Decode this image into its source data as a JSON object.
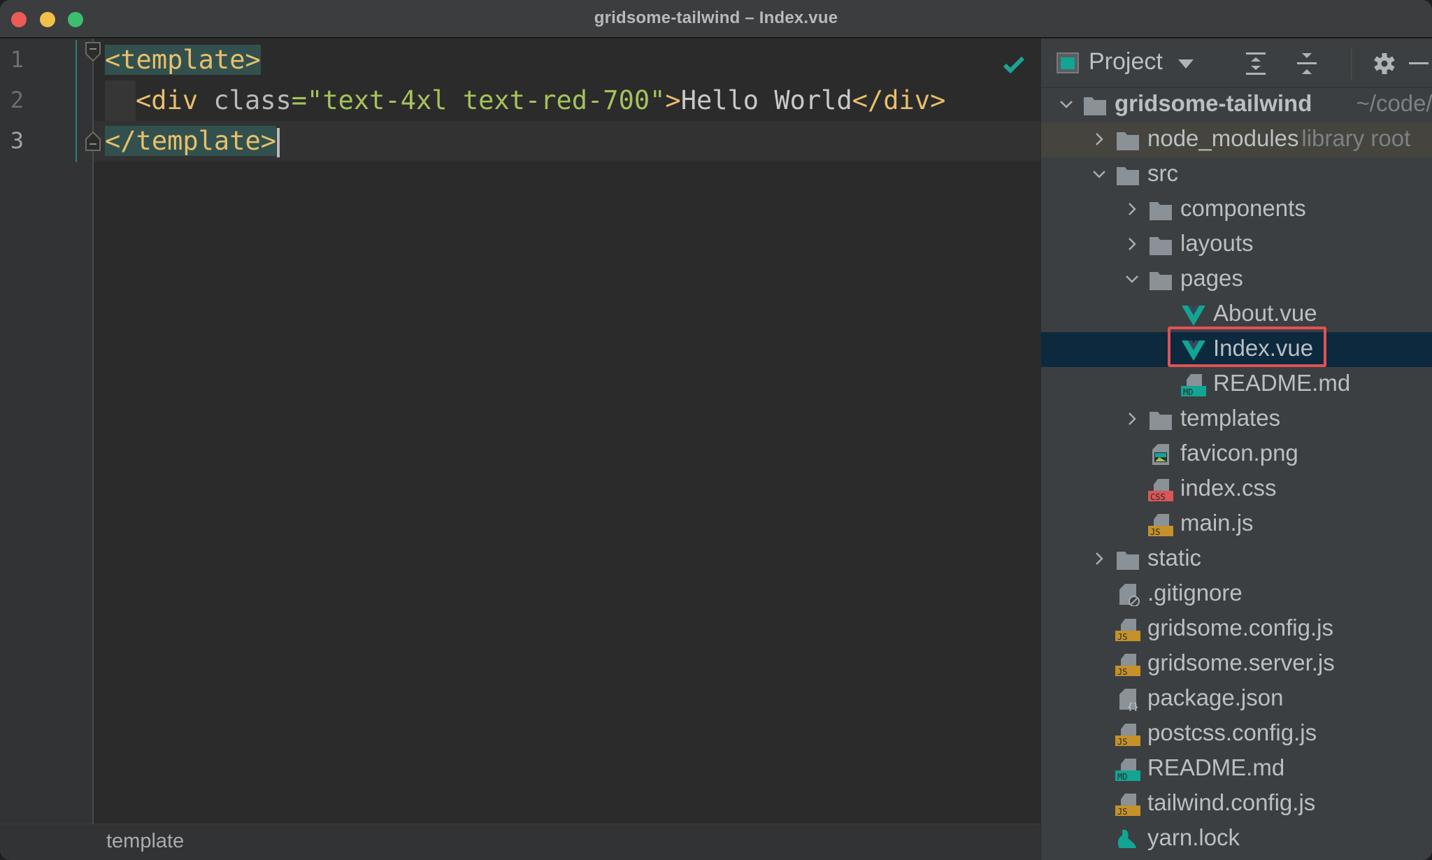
{
  "window": {
    "title": "gridsome-tailwind – Index.vue",
    "controls": [
      "close",
      "minimize",
      "zoom"
    ]
  },
  "editor": {
    "line_numbers": [
      "1",
      "2",
      "3"
    ],
    "current_line": 3,
    "lines": [
      [
        {
          "t": "tag",
          "v": "<template>"
        }
      ],
      [
        {
          "t": "tag",
          "v": "<div "
        },
        {
          "t": "attr",
          "v": "class"
        },
        {
          "t": "str",
          "v": "=\"text-4xl text-red-700\""
        },
        {
          "t": "tag",
          "v": ">"
        },
        {
          "t": "text",
          "v": "Hello World"
        },
        {
          "t": "tag",
          "v": "</div>"
        }
      ],
      [
        {
          "t": "tag",
          "v": "</template>"
        }
      ]
    ],
    "inspection_status_icon": "check-icon",
    "inspection_color": "#1aa396",
    "breadcrumb": "template"
  },
  "project_panel": {
    "title": "Project",
    "toolbar_icons": [
      "expand-all-icon",
      "collapse-all-icon",
      "gear-icon",
      "hide-icon"
    ],
    "tree": [
      {
        "depth": 0,
        "chevron": "down",
        "icon": "folder",
        "label": "gridsome-tailwind",
        "hint": "~/code/g",
        "bold": true
      },
      {
        "depth": 1,
        "chevron": "right",
        "icon": "folder",
        "label": "node_modules",
        "hint": "library root",
        "library": true
      },
      {
        "depth": 1,
        "chevron": "down",
        "icon": "folder",
        "label": "src"
      },
      {
        "depth": 2,
        "chevron": "right",
        "icon": "folder",
        "label": "components"
      },
      {
        "depth": 2,
        "chevron": "right",
        "icon": "folder",
        "label": "layouts"
      },
      {
        "depth": 2,
        "chevron": "down",
        "icon": "folder",
        "label": "pages"
      },
      {
        "depth": 3,
        "chevron": "none",
        "icon": "vue",
        "label": "About.vue"
      },
      {
        "depth": 3,
        "chevron": "none",
        "icon": "vue",
        "label": "Index.vue",
        "selected": true,
        "highlighted": true
      },
      {
        "depth": 3,
        "chevron": "none",
        "icon": "md",
        "label": "README.md"
      },
      {
        "depth": 2,
        "chevron": "right",
        "icon": "folder",
        "label": "templates"
      },
      {
        "depth": 2,
        "chevron": "none",
        "icon": "png",
        "label": "favicon.png"
      },
      {
        "depth": 2,
        "chevron": "none",
        "icon": "css",
        "label": "index.css"
      },
      {
        "depth": 2,
        "chevron": "none",
        "icon": "js",
        "label": "main.js"
      },
      {
        "depth": 1,
        "chevron": "right",
        "icon": "folder",
        "label": "static"
      },
      {
        "depth": 1,
        "chevron": "none",
        "icon": "gitignore",
        "label": ".gitignore"
      },
      {
        "depth": 1,
        "chevron": "none",
        "icon": "js",
        "label": "gridsome.config.js"
      },
      {
        "depth": 1,
        "chevron": "none",
        "icon": "js",
        "label": "gridsome.server.js"
      },
      {
        "depth": 1,
        "chevron": "none",
        "icon": "json",
        "label": "package.json"
      },
      {
        "depth": 1,
        "chevron": "none",
        "icon": "js",
        "label": "postcss.config.js"
      },
      {
        "depth": 1,
        "chevron": "none",
        "icon": "md",
        "label": "README.md"
      },
      {
        "depth": 1,
        "chevron": "none",
        "icon": "js",
        "label": "tailwind.config.js"
      },
      {
        "depth": 1,
        "chevron": "none",
        "icon": "yarn",
        "label": "yarn.lock"
      }
    ],
    "badge_labels": {
      "js": "JS",
      "css": "CSS",
      "md": "MD"
    },
    "colors": {
      "vue": "#12a593",
      "js": "#c4912a",
      "css": "#d95658",
      "md": "#12a593",
      "folder": "#8a9197",
      "selection": "#0d293e",
      "highlight": "#e05254"
    }
  }
}
